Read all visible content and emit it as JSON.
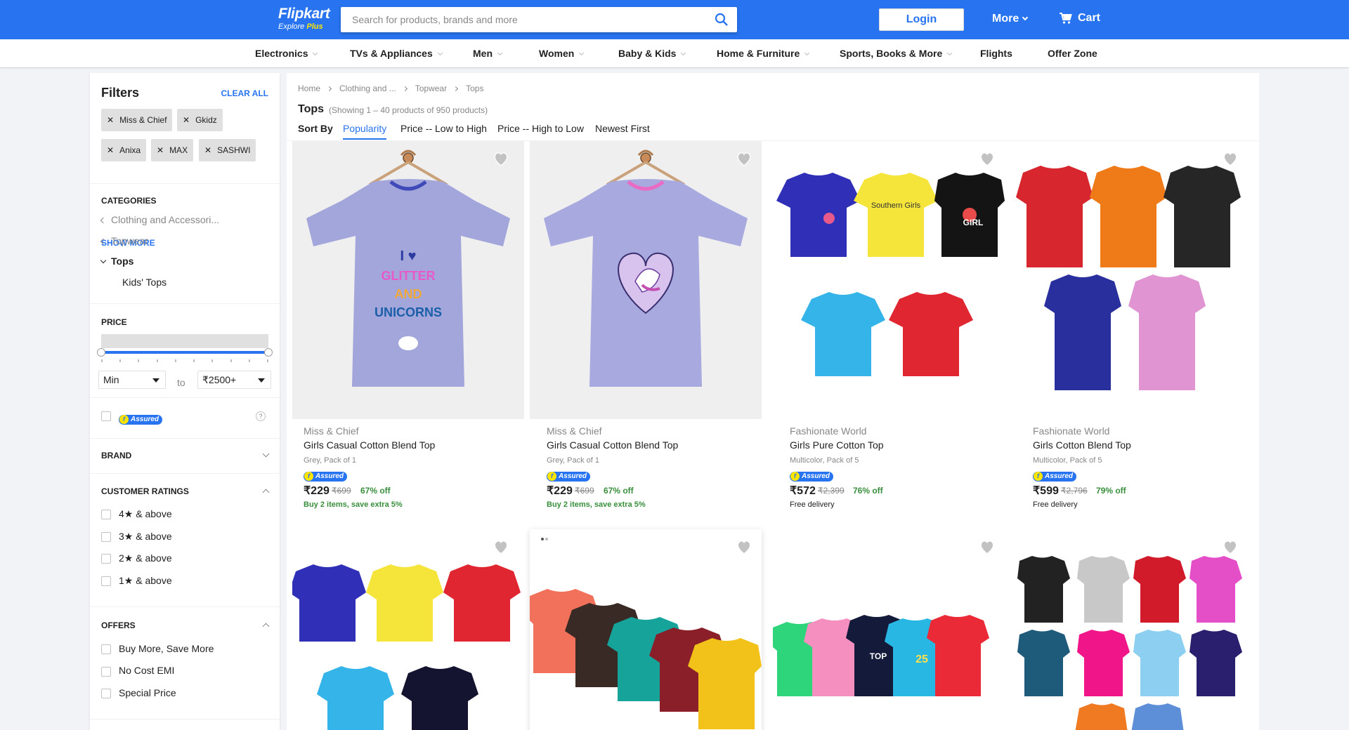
{
  "header": {
    "logo": "Flipkart",
    "tagline": "Explore",
    "tagline_plus": "Plus",
    "search_placeholder": "Search for products, brands and more",
    "login": "Login",
    "more": "More",
    "cart": "Cart"
  },
  "nav": [
    "Electronics",
    "TVs & Appliances",
    "Men",
    "Women",
    "Baby & Kids",
    "Home & Furniture",
    "Sports, Books & More",
    "Flights",
    "Offer Zone"
  ],
  "filters": {
    "title": "Filters",
    "clear_all": "CLEAR ALL",
    "chips": [
      "Miss & Chief",
      "Gkidz",
      "Anixa",
      "MAX",
      "SASHWI"
    ],
    "show_more": "SHOW MORE",
    "categories_title": "CATEGORIES",
    "cat_parent1": "Clothing and Accessori...",
    "cat_parent2": "Topwear",
    "cat_active": "Tops",
    "cat_sub": "Kids' Tops",
    "price_title": "PRICE",
    "price_min": "Min",
    "price_to": "to",
    "price_max": "₹2500+",
    "assured_label": "Assured",
    "brand_title": "BRAND",
    "ratings_title": "CUSTOMER RATINGS",
    "ratings": [
      "4★ & above",
      "3★ & above",
      "2★ & above",
      "1★ & above"
    ],
    "offers_title": "OFFERS",
    "offers": [
      "Buy More, Save More",
      "No Cost EMI",
      "Special Price"
    ]
  },
  "breadcrumbs": [
    "Home",
    "Clothing and ...",
    "Topwear",
    "Tops"
  ],
  "listing": {
    "title": "Tops",
    "count": "(Showing 1 – 40 products of 950 products)",
    "sort_by": "Sort By",
    "sort_options": [
      "Popularity",
      "Price -- Low to High",
      "Price -- High to Low",
      "Newest First"
    ],
    "active_sort": "Popularity"
  },
  "products": [
    {
      "brand": "Miss & Chief",
      "name": "Girls Casual Cotton Blend Top",
      "variant": "Grey, Pack of 1",
      "assured": "Assured",
      "price": "₹229",
      "mrp": "₹699",
      "off": "67% off",
      "extra": "Buy 2 items, save extra 5%"
    },
    {
      "brand": "Miss & Chief",
      "name": "Girls Casual Cotton Blend Top",
      "variant": "Grey, Pack of 1",
      "assured": "Assured",
      "price": "₹229",
      "mrp": "₹699",
      "off": "67% off",
      "extra": "Buy 2 items, save extra 5%"
    },
    {
      "brand": "Fashionate World",
      "name": "Girls Pure Cotton Top",
      "variant": "Multicolor, Pack of 5",
      "assured": "Assured",
      "price": "₹572",
      "mrp": "₹2,399",
      "off": "76% off",
      "extra": "Free delivery"
    },
    {
      "brand": "Fashionate World",
      "name": "Girls Cotton Blend Top",
      "variant": "Multicolor, Pack of 5",
      "assured": "Assured",
      "price": "₹599",
      "mrp": "₹2,796",
      "off": "79% off",
      "extra": "Free delivery"
    }
  ],
  "colors": {
    "brand_blue": "#2874f0",
    "logo_yellow": "#ffe500",
    "green": "#388e3c",
    "muted": "#878787"
  },
  "icons": [
    "search-icon",
    "cart-icon",
    "heart-icon",
    "close-icon",
    "chevron-down-icon",
    "chevron-up-icon",
    "chevron-left-icon",
    "chevron-right-icon",
    "question-icon"
  ]
}
